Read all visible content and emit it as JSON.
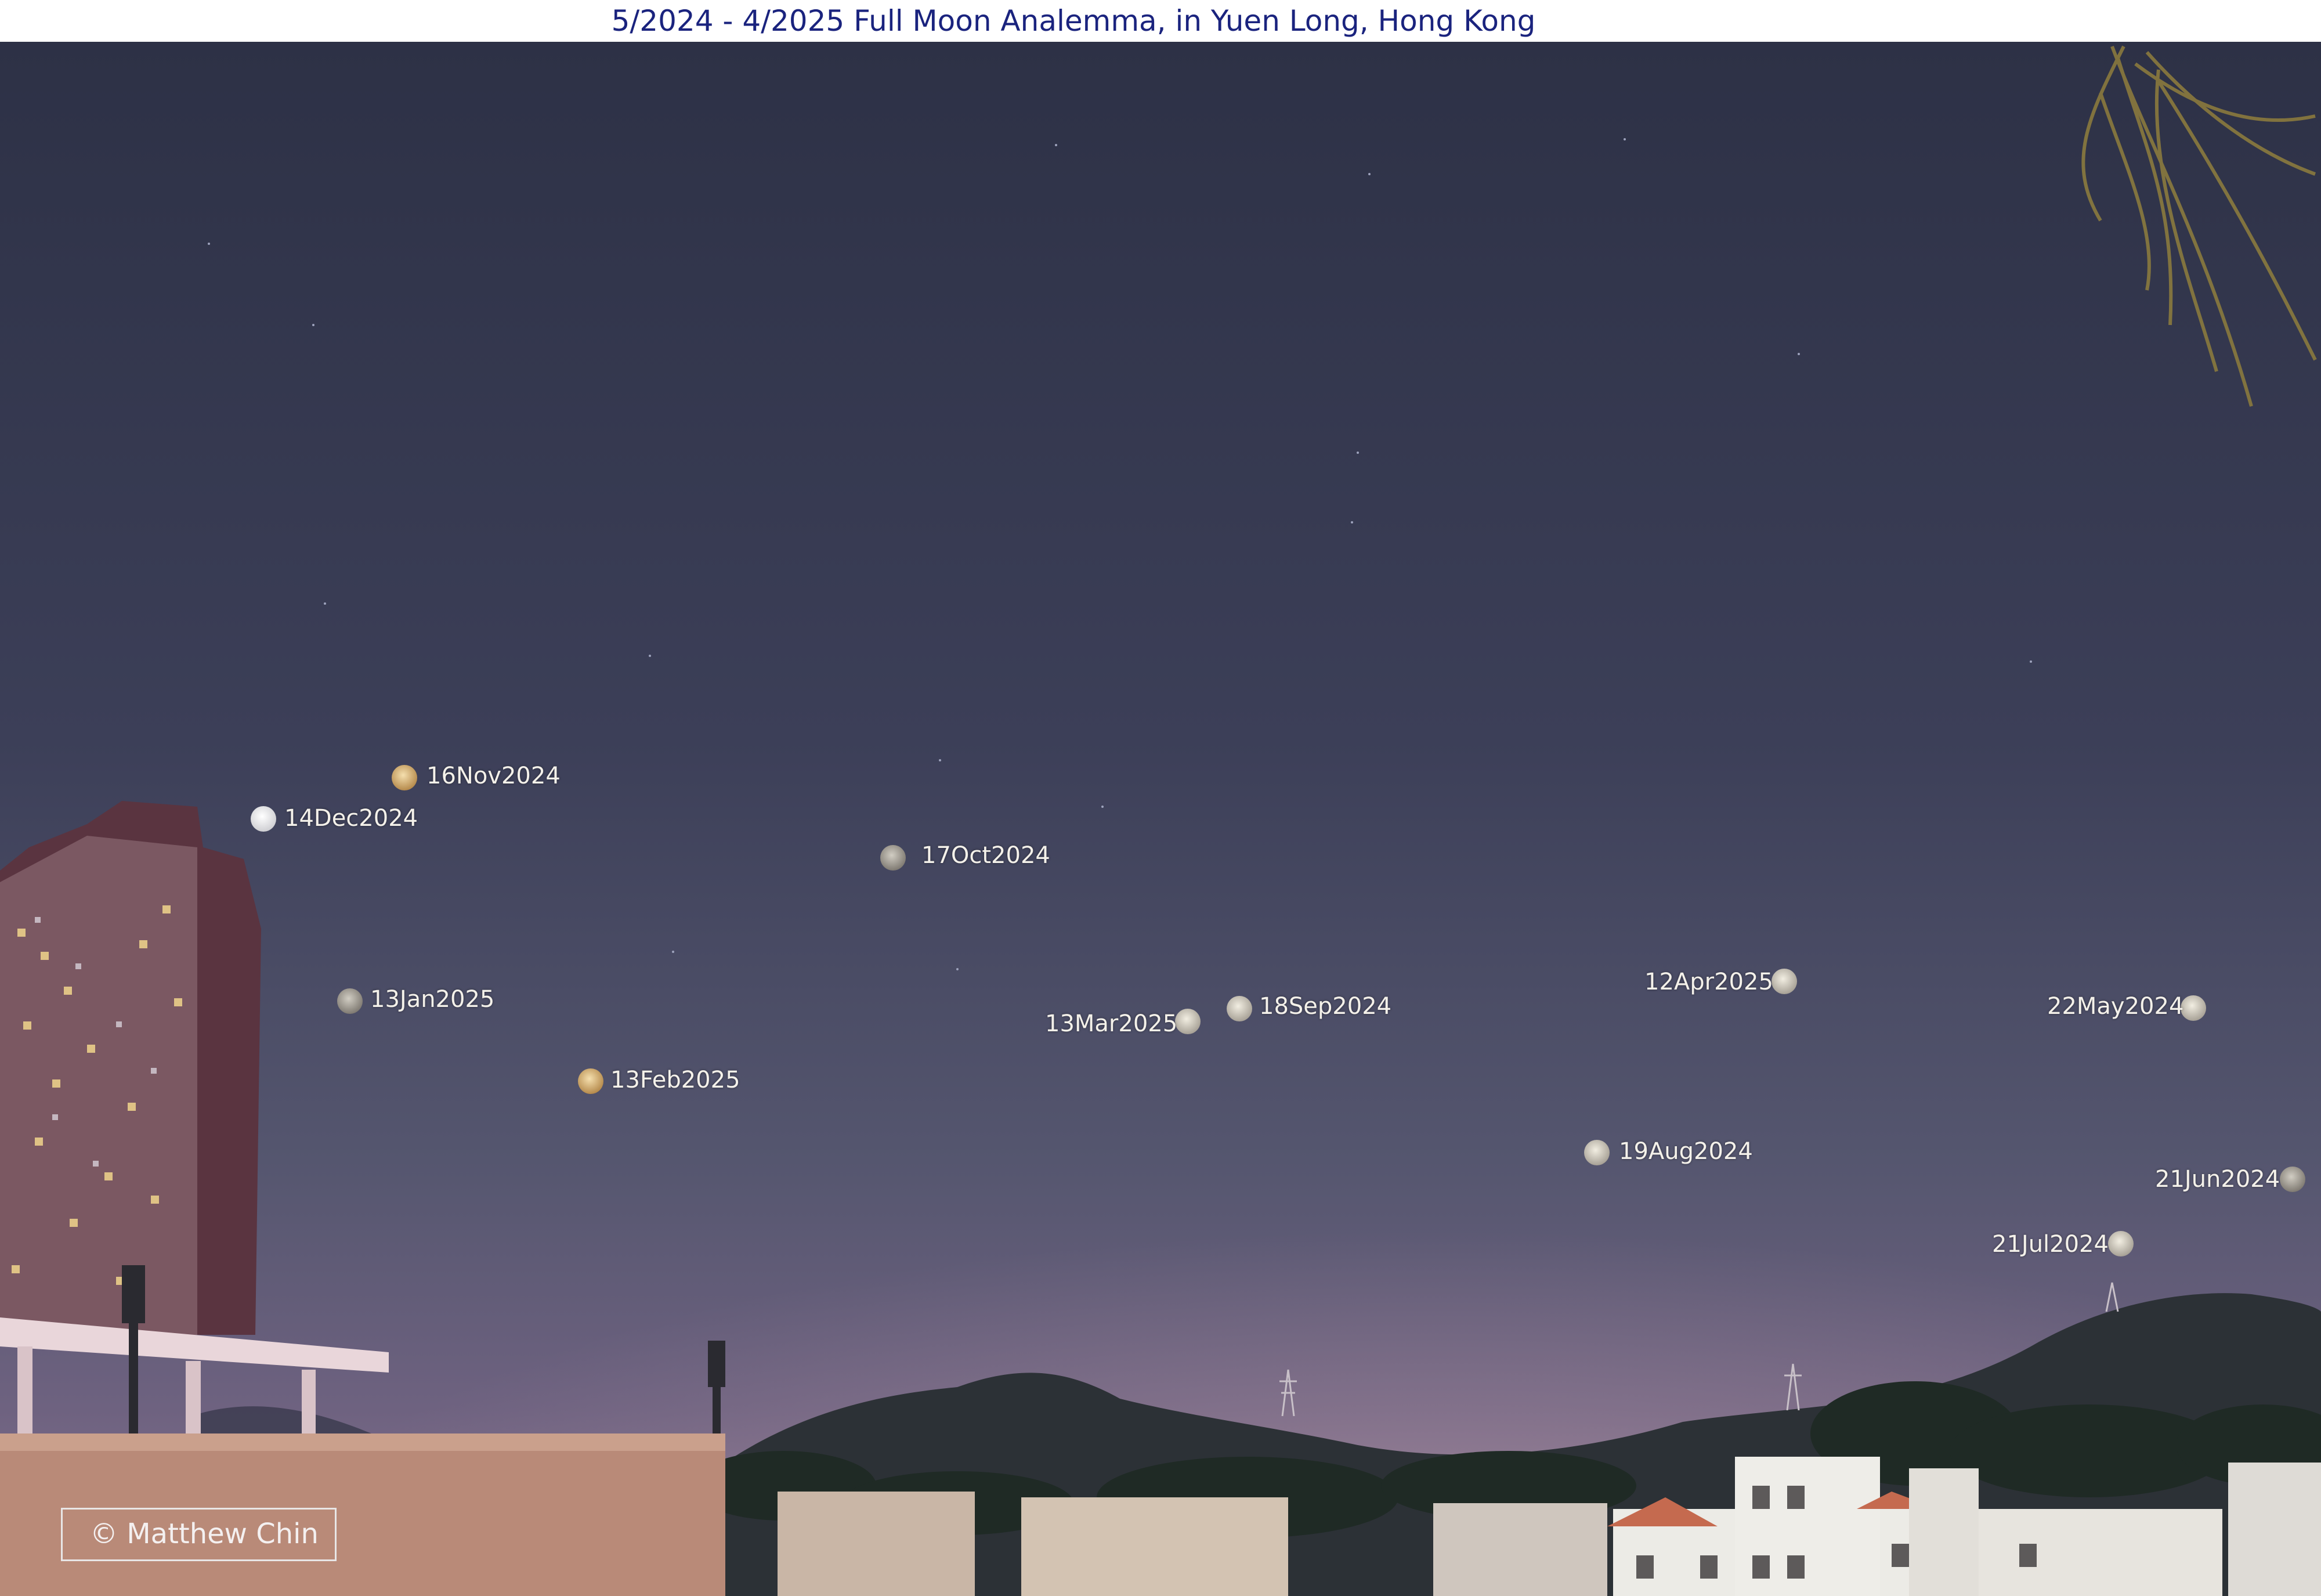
{
  "title": "5/2024 - 4/2025 Full Moon Analemma, in Yuen Long, Hong Kong",
  "copyright": "© Matthew Chin",
  "colors": {
    "title": "#1a237e",
    "sky_top": "#2e3247",
    "sky_bottom": "#7e6c86",
    "label": "#f4f1ea"
  },
  "moons": [
    {
      "label": "16Nov2024",
      "tone": "golden"
    },
    {
      "label": "14Dec2024",
      "tone": "white"
    },
    {
      "label": "17Oct2024",
      "tone": "grey"
    },
    {
      "label": "13Jan2025",
      "tone": "grey"
    },
    {
      "label": "13Feb2025",
      "tone": "golden"
    },
    {
      "label": "13Mar2025",
      "tone": "pale"
    },
    {
      "label": "18Sep2024",
      "tone": "pale"
    },
    {
      "label": "12Apr2025",
      "tone": "pale"
    },
    {
      "label": "22May2024",
      "tone": "pale"
    },
    {
      "label": "19Aug2024",
      "tone": "pale"
    },
    {
      "label": "21Jun2024",
      "tone": "grey"
    },
    {
      "label": "21Jul2024",
      "tone": "pale"
    }
  ]
}
